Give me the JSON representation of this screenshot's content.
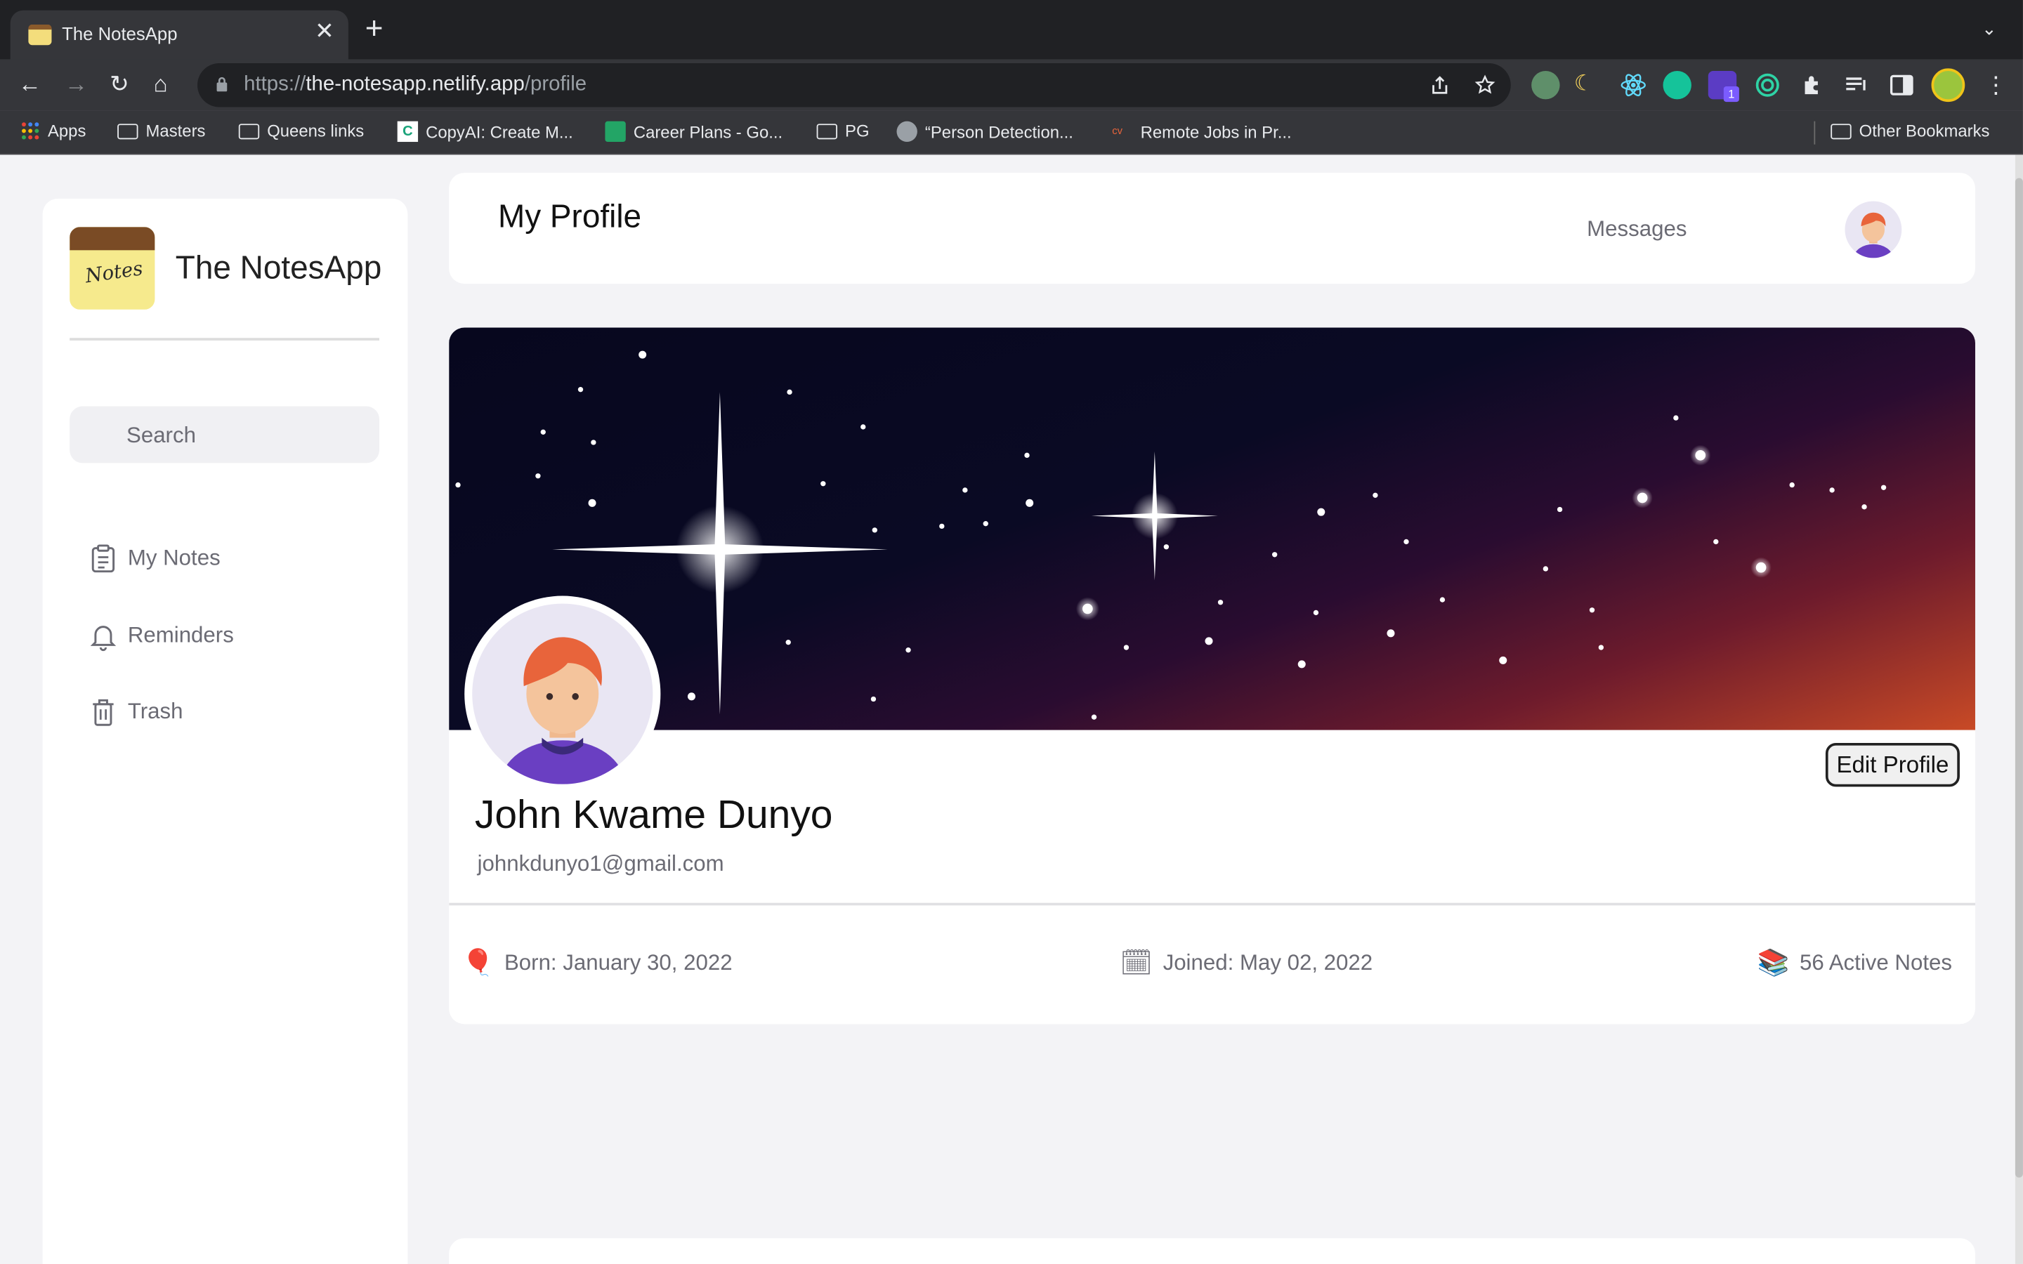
{
  "browser": {
    "tab_title": "The NotesApp",
    "tab_close": "✕",
    "new_tab": "+",
    "tab_list": "⌄",
    "url_scheme": "https://",
    "url_host": "the-notesapp.netlify.app",
    "url_path": "/profile",
    "nav": {
      "back": "←",
      "forward": "→",
      "reload": "↻",
      "home": "⌂"
    },
    "extension_badge": "1",
    "bookmarks": {
      "apps": "Apps",
      "masters": "Masters",
      "queens": "Queens links",
      "copyai": "CopyAI: Create M...",
      "career": "Career Plans - Go...",
      "pg": "PG",
      "person": "“Person Detection...",
      "remote": "Remote Jobs in Pr...",
      "other": "Other Bookmarks"
    }
  },
  "sidebar": {
    "logo_text": "Notes",
    "app_name": "The NotesApp",
    "search_placeholder": "Search",
    "items": [
      {
        "label": "My Notes",
        "icon": "clipboard-icon"
      },
      {
        "label": "Reminders",
        "icon": "bell-icon"
      },
      {
        "label": "Trash",
        "icon": "trash-icon"
      }
    ]
  },
  "header": {
    "title": "My Profile",
    "messages": "Messages"
  },
  "profile": {
    "name": "John Kwame Dunyo",
    "email": "johnkdunyo1@gmail.com",
    "edit_label": "Edit Profile",
    "born": "Born: January 30, 2022",
    "joined": "Joined: May 02, 2022",
    "notes": "56 Active Notes",
    "born_icon": "🎈",
    "joined_icon": "🗓",
    "notes_icon": "📚"
  },
  "colors": {
    "accent": "#111111",
    "sidebar_bg": "#ffffff",
    "page_bg": "#f3f3f6",
    "muted_text": "#6b6b74"
  }
}
